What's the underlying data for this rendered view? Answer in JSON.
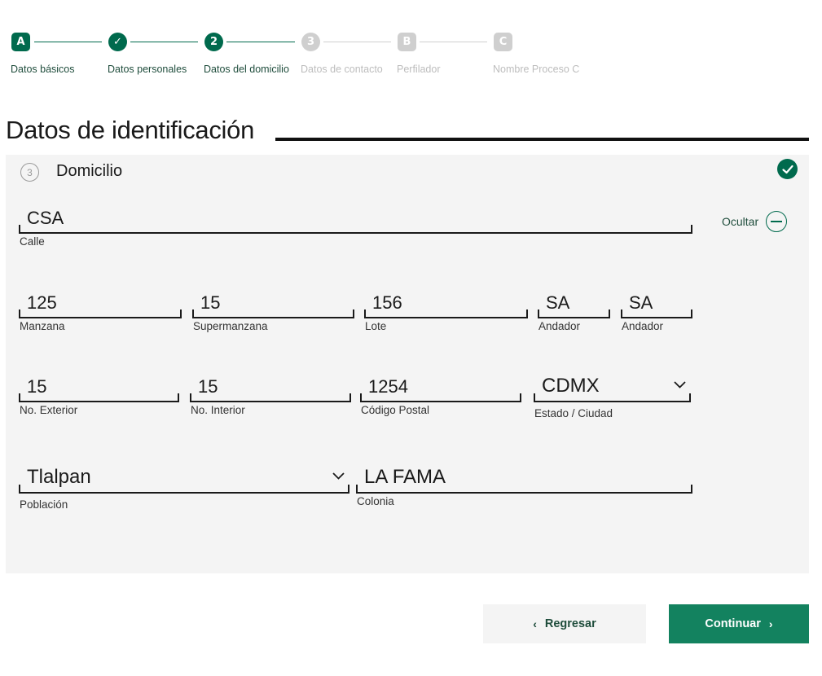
{
  "stepper": {
    "steps": [
      {
        "badge": "A",
        "label": "Datos básicos",
        "state": "active"
      },
      {
        "badge": "✓",
        "label": "Datos personales",
        "state": "done"
      },
      {
        "badge": "2",
        "label": "Datos del domicilio",
        "state": "current"
      },
      {
        "badge": "3",
        "label": "Datos de contacto",
        "state": "pending"
      },
      {
        "badge": "B",
        "label": "Perfilador",
        "state": "pending"
      },
      {
        "badge": "C",
        "label": "Nombre Proceso C",
        "state": "pending"
      }
    ]
  },
  "section": {
    "title": "Datos de identificación"
  },
  "card": {
    "number": "3",
    "title": "Domicilio",
    "toggle_label": "Ocultar",
    "status_icon": "check-circle-icon"
  },
  "fields": {
    "calle": {
      "value": "CSA",
      "label": "Calle"
    },
    "manzana": {
      "value": "125",
      "label": "Manzana"
    },
    "supermanzana": {
      "value": "15",
      "label": "Supermanzana"
    },
    "lote": {
      "value": "156",
      "label": "Lote"
    },
    "andador1": {
      "value": "SA",
      "label": "Andador"
    },
    "andador2": {
      "value": "SA",
      "label": "Andador"
    },
    "no_exterior": {
      "value": "15",
      "label": "No. Exterior"
    },
    "no_interior": {
      "value": "15",
      "label": "No. Interior"
    },
    "codigo_postal": {
      "value": "1254",
      "label": "Código Postal"
    },
    "estado": {
      "value": "CDMX",
      "label": "Estado / Ciudad"
    },
    "poblacion": {
      "value": "Tlalpan",
      "label": "Población"
    },
    "colonia": {
      "value": "LA FAMA",
      "label": "Colonia"
    }
  },
  "buttons": {
    "back_label": "Regresar",
    "next_label": "Continuar"
  },
  "colors": {
    "brand_green": "#006a4d",
    "button_green": "#13825f",
    "disabled_gray": "#cfcfcf",
    "panel_bg": "#f4f4f4"
  }
}
